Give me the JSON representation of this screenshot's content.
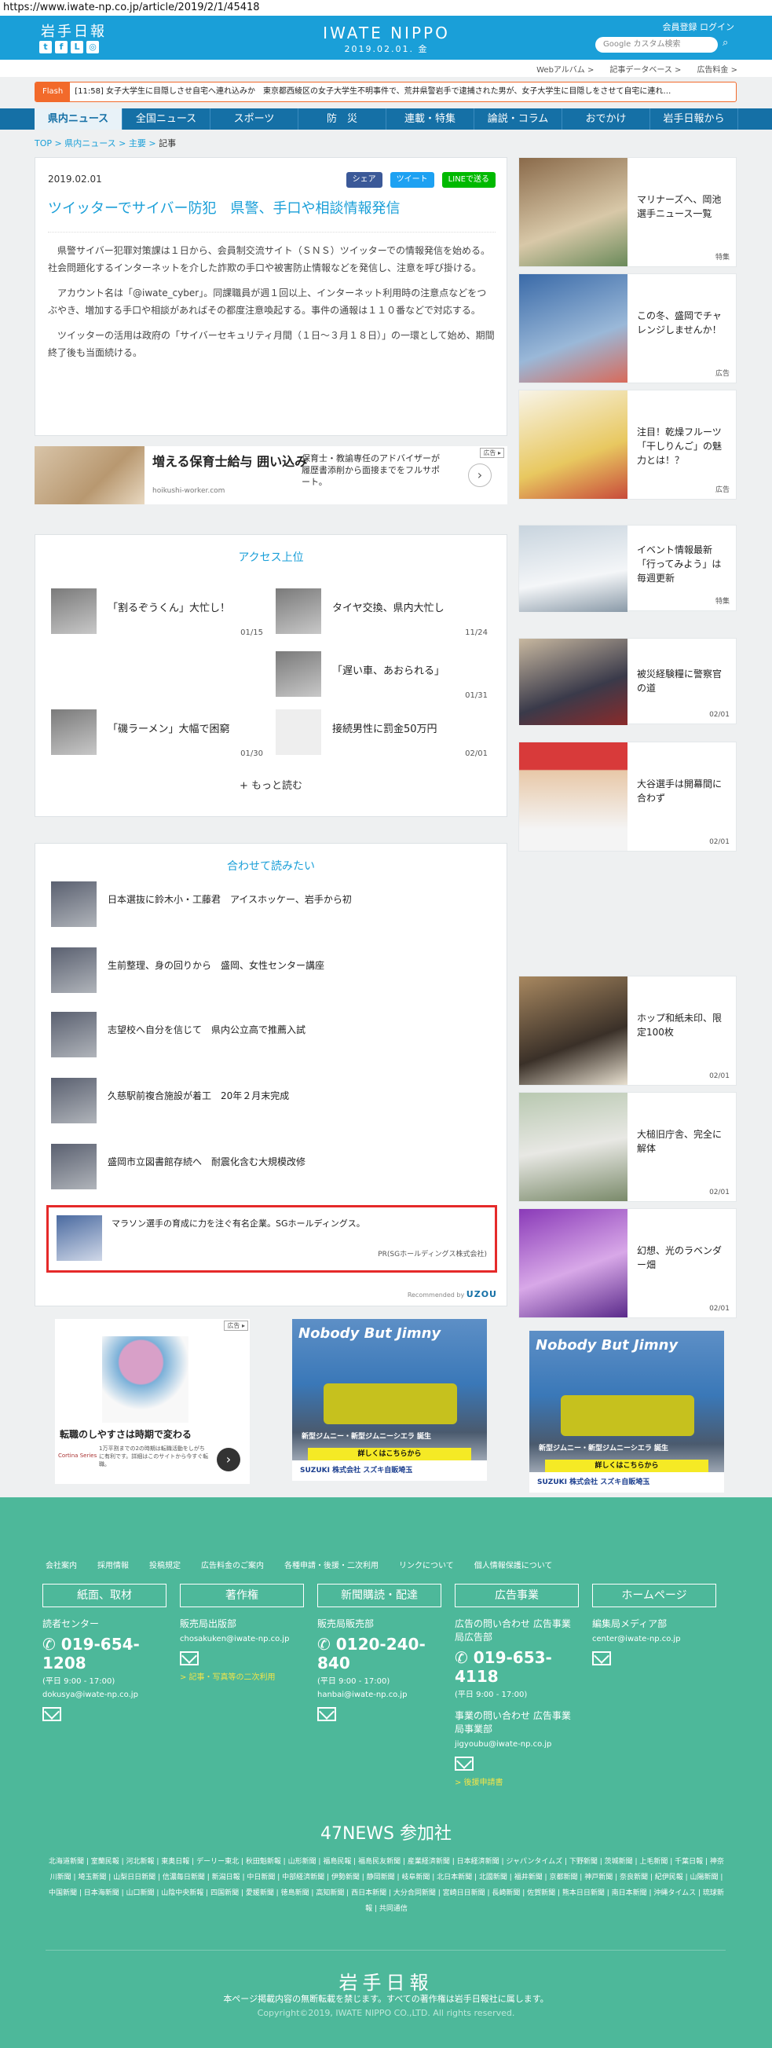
{
  "browser": {
    "url": "https://www.iwate-np.co.jp/article/2019/2/1/45418"
  },
  "header": {
    "logo": "岩手日報",
    "brand": "IWATE NIPPO",
    "date": "2019.02.01. 金",
    "register": "会員登録",
    "login": "ログイン",
    "search_placeholder": "Google カスタム検索",
    "social": [
      "t",
      "f",
      "L",
      "◎"
    ]
  },
  "utilnav": [
    "Webアルバム >",
    "記事データベース >",
    "広告料金 >"
  ],
  "flash": {
    "label": "Flash",
    "text": "[11:58]  女子大学生に目隠しさせ自宅へ連れ込みか　東京都西綾区の女子大学生不明事件で、荒井県警岩手で逮捕された男が、女子大学生に目隠しをさせて自宅に連れ…"
  },
  "nav": [
    "県内ニュース",
    "全国ニュース",
    "スポーツ",
    "防　災",
    "連載・特集",
    "論説・コラム",
    "おでかけ",
    "岩手日報から"
  ],
  "breadcrumb": {
    "top": "TOP",
    "news": "県内ニュース",
    "major": "主要",
    "current": "記事"
  },
  "article": {
    "date": "2019.02.01",
    "share": "シェア",
    "tweet": "ツイート",
    "line": "LINEで送る",
    "title": "ツイッターでサイバー防犯　県警、手口や相談情報発信",
    "paragraphs": [
      "県警サイバー犯罪対策課は１日から、会員制交流サイト（ＳＮＳ）ツイッターでの情報発信を始める。社会問題化するインターネットを介した詐欺の手口や被害防止情報などを発信し、注意を呼び掛ける。",
      "アカウント名は「@iwate_cyber」。同課職員が週１回以上、インターネット利用時の注意点などをつぶやき、増加する手口や相談があればその都度注意喚起する。事件の通報は１１０番などで対応する。",
      "ツイッターの活用は政府の「サイバーセキュリティ月間（１日～３月１８日）」の一環として始め、期間終了後も当面続ける。"
    ]
  },
  "ad_banner": {
    "headline": "増える保育士給与 囲い込み",
    "source": "hoikushi-worker.com",
    "desc": "保育士・教諭専任のアドバイザーが履歴書添削から面接までをフルサポート。",
    "tag": "広告 ▸"
  },
  "ranking": {
    "title": "アクセス上位",
    "more": "+  もっと読む",
    "items": [
      {
        "title": "「割るぞうくん」大忙し！",
        "date": "01/15"
      },
      {
        "title": "タイヤ交換、県内大忙し",
        "date": "11/24"
      },
      {
        "title": "「遅い車、あおられる」",
        "date": "01/31"
      },
      {
        "title": "「磯ラーメン」大幅で困窮",
        "date": "01/30"
      },
      {
        "title": "接続男性に罰金50万円",
        "date": "02/01"
      }
    ]
  },
  "related": {
    "title": "合わせて読みたい",
    "items": [
      "日本選抜に鈴木小・工藤君　アイスホッケー、岩手から初",
      "生前整理、身の回りから　盛岡、女性センター講座",
      "志望校へ自分を信じて　県内公立高で推薦入試",
      "久慈駅前複合施設が着工　20年２月末完成",
      "盛岡市立図書館存続へ　耐震化含む大規模改修"
    ],
    "promo": {
      "title": "マラソン選手の育成に力を注ぐ有名企業。SGホールディングス。",
      "sponsor": "PR(SGホールディングス株式会社)"
    },
    "recommended_by": "Recommended by",
    "recommend_brand": "UZOU"
  },
  "sidebar": [
    {
      "title": "マリナーズへ、岡池選手ニュース一覧",
      "tag": "特集"
    },
    {
      "title": "この冬、盛岡でチャレンジしませんか！",
      "tag": "広告"
    },
    {
      "title": "注目！乾燥フルーツ「干しりんご」の魅力とは！？",
      "tag": "広告"
    },
    {
      "title": "イベント情報最新「行ってみよう」は毎週更新",
      "tag": "特集"
    },
    {
      "title": "被災経験糧に警察官の道",
      "tag": "02/01"
    },
    {
      "title": "大谷選手は開幕間に合わず",
      "tag": "02/01"
    },
    {
      "title": "ホップ和紙未印、限定100枚",
      "tag": "02/01"
    },
    {
      "title": "大槌旧庁舎、完全に解体",
      "tag": "02/01"
    },
    {
      "title": "幻想、光のラベンダー畑",
      "tag": "02/01"
    }
  ],
  "bottom_ads": {
    "senior": {
      "text": "転職のしやすさは時期で変わる",
      "small": "1万平割までの2の時期は転職活動をしがちに有利です。詳細はこのサイトから今すぐ転職。",
      "tag": "広告 ▸",
      "source": "Cortina Series"
    },
    "jimny": {
      "headline": "Nobody But Jimny",
      "sub": "新型ジムニー・新型ジムニーシエラ 誕生",
      "cta": "詳しくはこちらから",
      "dealer": "SUZUKI 株式会社 スズキ自販埼玉"
    }
  },
  "footer": {
    "links": [
      "会社案内",
      "採用情報",
      "投稿規定",
      "広告料金のご案内",
      "各種申請・後援・二次利用",
      "リンクについて",
      "個人情報保護について"
    ],
    "cols": [
      {
        "btn": "紙面、取材",
        "l1": "読者センター",
        "phone": "019-654-1208",
        "hours": "(平日 9:00 - 17:00)",
        "mail": "dokusya@iwate-np.co.jp",
        "extra": ""
      },
      {
        "btn": "著作権",
        "l1": "販売局出版部",
        "phone": "",
        "hours": "",
        "mail": "chosakuken@iwate-np.co.jp",
        "extra": "> 記事・写真等の二次利用"
      },
      {
        "btn": "新聞購読・配達",
        "l1": "販売局販売部",
        "phone": "0120-240-840",
        "hours": "(平日 9:00 - 17:00)",
        "mail": "hanbai@iwate-np.co.jp",
        "extra": ""
      },
      {
        "btn": "広告事業",
        "l1": "広告の問い合わせ 広告事業局広告部",
        "phone": "019-653-4118",
        "hours": "(平日 9:00 - 17:00)",
        "mail": "jigyoubu@iwate-np.co.jp",
        "extra": "> 後援申請書",
        "l2": "事業の問い合わせ 広告事業局事業部"
      },
      {
        "btn": "ホームページ",
        "l1": "編集局メディア部",
        "phone": "",
        "hours": "",
        "mail": "center@iwate-np.co.jp",
        "extra": ""
      }
    ],
    "n47": "47NEWS 参加社",
    "papers": "北海道新聞 | 室蘭民報 | 河北新報 | 東奥日報 | デーリー東北 | 秋田魁新報 | 山形新聞 | 福島民報 | 福島民友新聞 | 産業経済新聞 | 日本経済新聞 | ジャパンタイムズ | 下野新聞 | 茨城新聞 | 上毛新聞 | 千葉日報 | 神奈川新聞 | 埼玉新聞 | 山梨日日新聞 | 信濃毎日新聞 | 新潟日報 | 中日新聞 | 中部経済新聞 | 伊勢新聞 | 静岡新聞 | 岐阜新聞 | 北日本新聞 | 北國新聞 | 福井新聞 | 京都新聞 | 神戸新聞 | 奈良新聞 | 紀伊民報 | 山陽新聞 | 中国新聞 | 日本海新聞 | 山口新聞 | 山陰中央新報 | 四国新聞 | 愛媛新聞 | 徳島新聞 | 高知新聞 | 西日本新聞 | 大分合同新聞 | 宮崎日日新聞 | 長崎新聞 | 佐賀新聞 | 熊本日日新聞 | 南日本新聞 | 沖縄タイムス | 琉球新報 | 共同通信",
    "logo": "岩手日報",
    "note": "本ページ掲載内容の無断転載を禁じます。すべての著作権は岩手日報社に属します。",
    "copy": "Copyright©2019, IWATE NIPPO CO.,LTD. All rights reserved."
  }
}
